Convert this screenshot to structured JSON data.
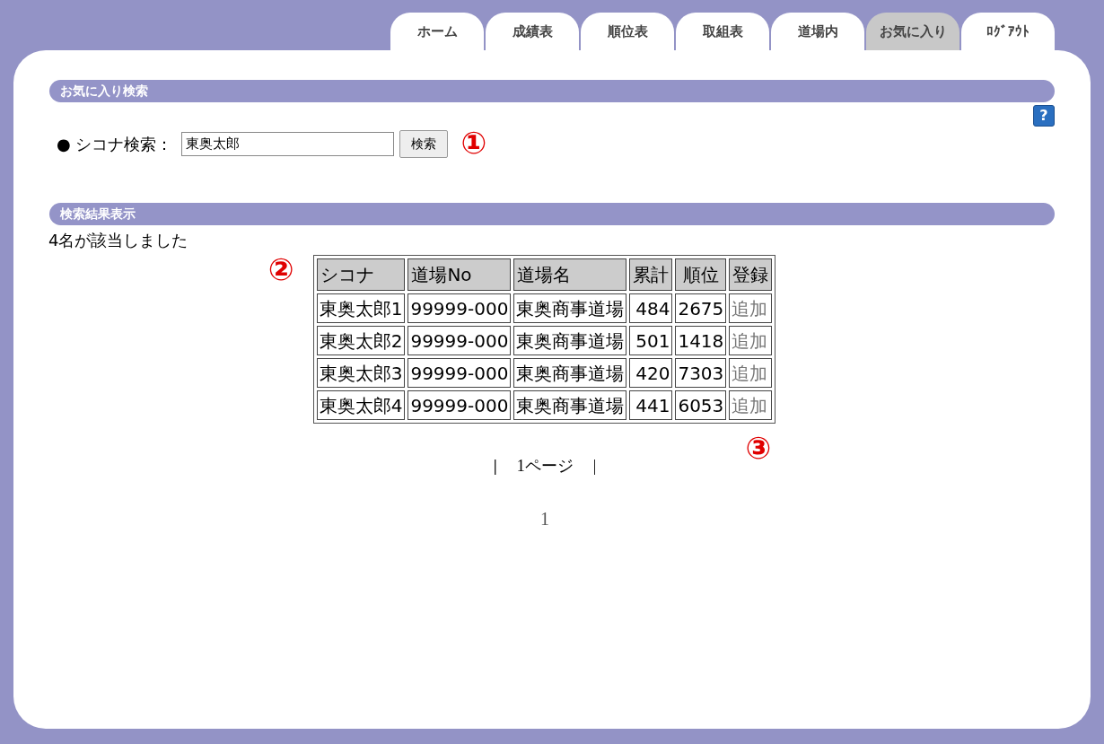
{
  "tabs": [
    {
      "label": "ホーム",
      "selected": false
    },
    {
      "label": "成績表",
      "selected": false
    },
    {
      "label": "順位表",
      "selected": false
    },
    {
      "label": "取組表",
      "selected": false
    },
    {
      "label": "道場内",
      "selected": false
    },
    {
      "label": "お気に入り",
      "selected": true
    },
    {
      "label": "ﾛｸﾞｱｳﾄ",
      "selected": false
    }
  ],
  "search_section": {
    "title": "お気に入り検索",
    "help_button": "?",
    "label": "● シコナ検索：",
    "field_value": "東奥太郎",
    "button": "検索",
    "annotation": "①"
  },
  "results_section": {
    "title": "検索結果表示",
    "count_text": "4名が該当しました",
    "annotation_table": "②",
    "annotation_add": "③",
    "table": {
      "columns": [
        "シコナ",
        "道場No",
        "道場名",
        "累計",
        "順位",
        "登録"
      ],
      "rows": [
        [
          "東奥太郎1",
          "99999-000",
          "東奥商事道場",
          "484",
          "2675",
          "追加"
        ],
        [
          "東奥太郎2",
          "99999-000",
          "東奥商事道場",
          "501",
          "1418",
          "追加"
        ],
        [
          "東奥太郎3",
          "99999-000",
          "東奥商事道場",
          "420",
          "7303",
          "追加"
        ],
        [
          "東奥太郎4",
          "99999-000",
          "東奥商事道場",
          "441",
          "6053",
          "追加"
        ]
      ]
    }
  },
  "pagination": {
    "bar_left": "|",
    "page_label": "1ページ",
    "bar_right": "|",
    "page_number": "1"
  }
}
